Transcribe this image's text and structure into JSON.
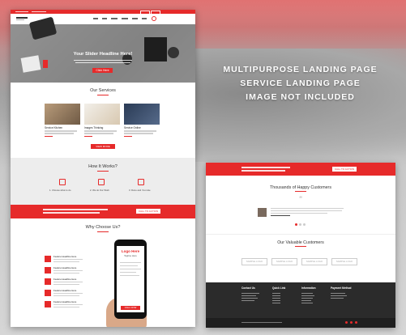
{
  "promo": {
    "line1": "MULTIPURPOSE LANDING PAGE",
    "line2": "SERVICE LANDING PAGE",
    "line3": "IMAGE NOT INCLUDED"
  },
  "left_page": {
    "hero": {
      "headline": "Your Slider Headline Here!",
      "button": "Click Here"
    },
    "services": {
      "title": "Our Services",
      "cards": [
        {
          "title": "Service Kitchen"
        },
        {
          "title": "Images Thinking"
        },
        {
          "title": "Service Online"
        }
      ],
      "button": "VIEW MORE SERVICE"
    },
    "how": {
      "title": "How It Works?",
      "steps": [
        {
          "label": "1. Choose what to do"
        },
        {
          "label": "2. We do Our Work"
        },
        {
          "label": "3. Done and You Like"
        }
      ]
    },
    "cta": {
      "button": "CALL TO ACTION"
    },
    "why": {
      "title": "Why Choose Us?",
      "items": [
        {
          "title": "Feature Headline Here"
        },
        {
          "title": "Feature Headline Here"
        },
        {
          "title": "Feature Headline Here"
        },
        {
          "title": "Feature Headline Here"
        },
        {
          "title": "Feature Headline Here"
        }
      ],
      "phone": {
        "title": "Logo Here",
        "subtitle": "Tagline Here",
        "button": "CALL NOW"
      }
    }
  },
  "right_page": {
    "cta_button": "CALL TO ACTION",
    "testimonials": {
      "title": "Thousands of Happy Customers"
    },
    "customers": {
      "title": "Our Valuable Customers",
      "logos": [
        "SAMPLE LOGO",
        "SAMPLE LOGO",
        "SAMPLE LOGO",
        "SAMPLE LOGO"
      ]
    },
    "footer": {
      "columns": [
        {
          "title": "Contact Us"
        },
        {
          "title": "Quick Link"
        },
        {
          "title": "Information"
        },
        {
          "title": "Payment Method"
        }
      ]
    }
  },
  "colors": {
    "accent": "#e62a2a",
    "footer": "#2b2b2b",
    "section_gray": "#ededed"
  }
}
